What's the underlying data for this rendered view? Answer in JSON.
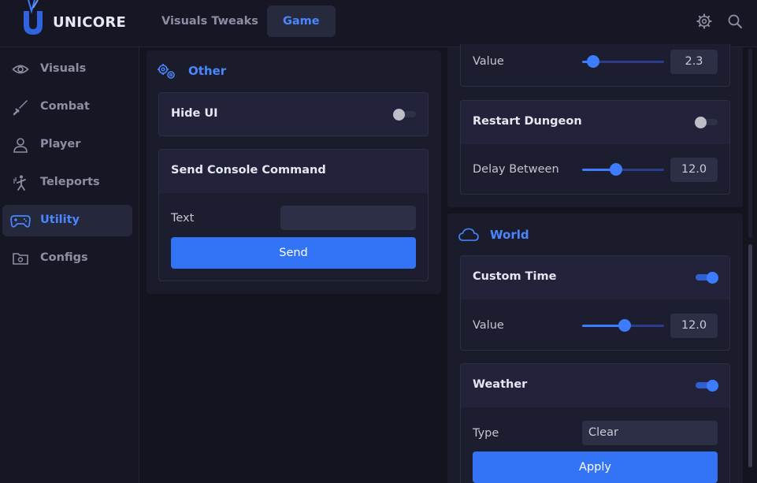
{
  "app": {
    "name": "UNICORE"
  },
  "top_tabs": [
    {
      "label": "Visuals Tweaks",
      "active": false
    },
    {
      "label": "Game",
      "active": true
    }
  ],
  "top_icons": [
    "gear-icon",
    "search-icon"
  ],
  "sidebar": {
    "items": [
      {
        "label": "Visuals",
        "icon": "eye-icon",
        "active": false
      },
      {
        "label": "Combat",
        "icon": "sword-icon",
        "active": false
      },
      {
        "label": "Player",
        "icon": "user-icon",
        "active": false
      },
      {
        "label": "Teleports",
        "icon": "teleport-icon",
        "active": false
      },
      {
        "label": "Utility",
        "icon": "gamepad-icon",
        "active": true
      },
      {
        "label": "Configs",
        "icon": "folder-gear-icon",
        "active": false
      }
    ]
  },
  "left": {
    "section_title": "Other",
    "hide_ui": {
      "label": "Hide UI",
      "enabled": false
    },
    "console": {
      "title": "Send Console Command",
      "text_label": "Text",
      "text_value": "",
      "send_label": "Send"
    }
  },
  "right": {
    "top_value": {
      "label": "Value",
      "value": "2.3",
      "level": 0.13
    },
    "restart_dungeon": {
      "label": "Restart Dungeon",
      "enabled": false,
      "delay_label": "Delay Between",
      "delay_value": "12.0",
      "delay_level": 0.41
    },
    "world": {
      "title": "World",
      "custom_time": {
        "label": "Custom Time",
        "enabled": true,
        "value_label": "Value",
        "value": "12.0",
        "level": 0.52
      },
      "weather": {
        "label": "Weather",
        "enabled": true,
        "type_label": "Type",
        "type_value": "Clear",
        "apply_label": "Apply"
      }
    }
  },
  "colors": {
    "accent": "#3d7bff",
    "background": "#14141f",
    "panel": "#1b1c2b"
  }
}
